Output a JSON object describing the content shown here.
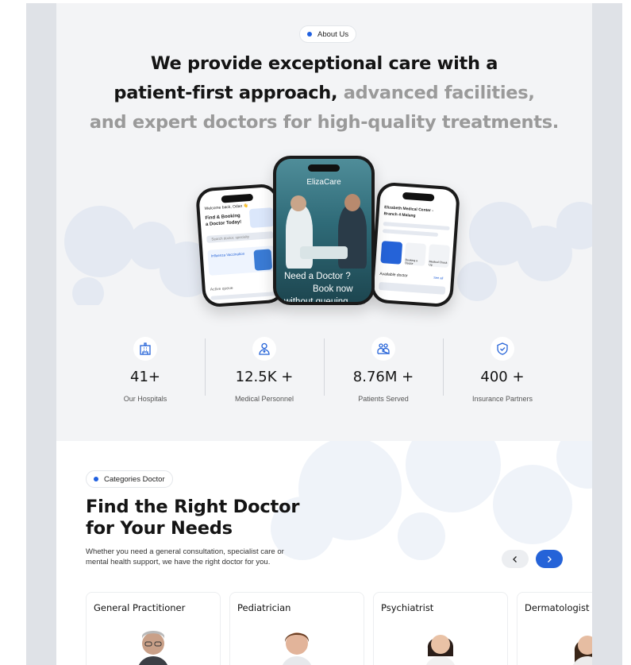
{
  "about": {
    "pill_label": "About Us",
    "headline_dark_1": "We provide exceptional care with a",
    "headline_dark_2": "patient-first approach,",
    "headline_muted_2": " advanced facilities,",
    "headline_muted_3": "and expert doctors for high-quality treatments."
  },
  "phones": {
    "left": {
      "greeting": "Welcome back, Odan 👋",
      "title_1": "Find & Booking",
      "title_2": "a Doctor Today!",
      "search": "Search doctor, specialty",
      "card_title": "Influenza Vaccination",
      "section": "Active queue"
    },
    "center": {
      "app_name": "ElizaCare",
      "cta_1": "Need a Doctor ?",
      "cta_2": "Book now",
      "cta_3": "without queuing"
    },
    "right": {
      "title_1": "Elizabeth Medical Center -",
      "title_2": "Branch 4 Malang",
      "tab_1": "Booking a Doctor",
      "tab_2": "Medical Check Up",
      "section": "Available doctor",
      "see_all": "See all"
    }
  },
  "stats": [
    {
      "icon": "hospital-icon",
      "value": "41+",
      "label": "Our Hospitals"
    },
    {
      "icon": "medical-personnel-icon",
      "value": "12.5K +",
      "label": "Medical Personnel"
    },
    {
      "icon": "patients-icon",
      "value": "8.76M +",
      "label": "Patients Served"
    },
    {
      "icon": "shield-icon",
      "value": "400 +",
      "label": "Insurance Partners"
    }
  ],
  "doctors": {
    "pill_label": "Categories Doctor",
    "title_1": "Find the Right Doctor",
    "title_2": "for Your Needs",
    "description": "Whether you need a general consultation, specialist care or mental health support, we have the right doctor for you.",
    "cards": [
      {
        "title": "General Practitioner"
      },
      {
        "title": "Pediatrician"
      },
      {
        "title": "Psychiatrist"
      },
      {
        "title": "Dermatologist"
      }
    ]
  },
  "colors": {
    "accent": "#2563d8",
    "section_bg": "#f3f4f6",
    "frame": "#dfe2e7",
    "muted_text": "#9a9a9a"
  }
}
